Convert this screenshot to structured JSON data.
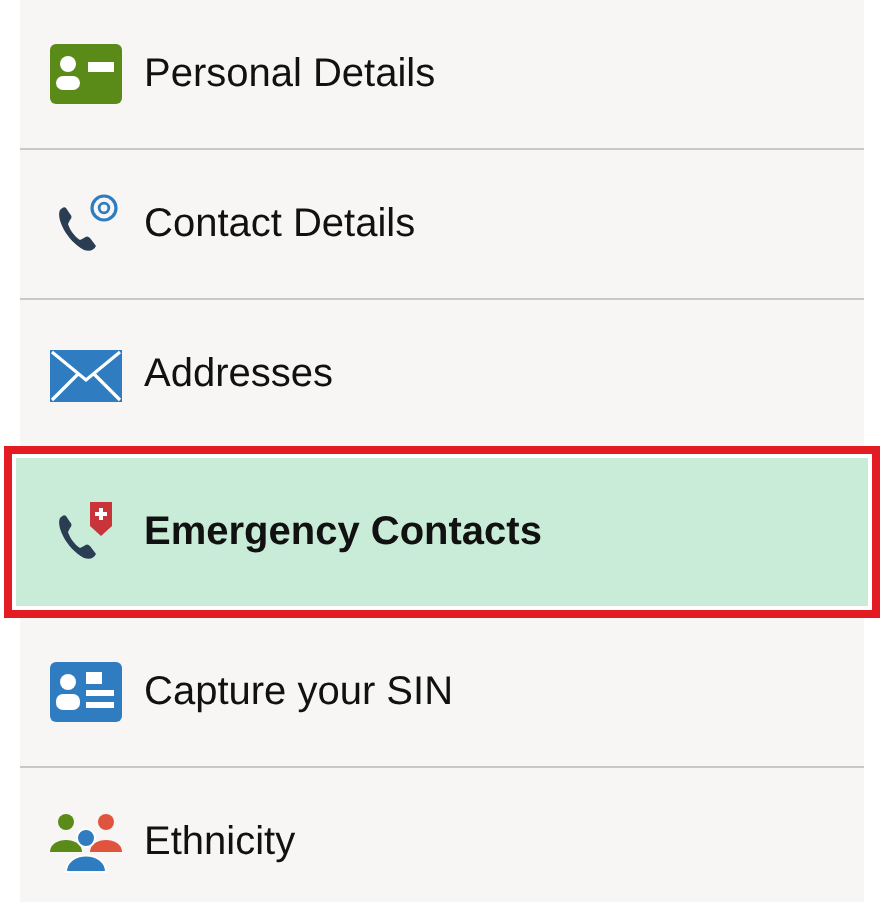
{
  "menu": [
    {
      "label": "Personal Details",
      "selected": false
    },
    {
      "label": "Contact Details",
      "selected": false
    },
    {
      "label": "Addresses",
      "selected": false
    },
    {
      "label": "Emergency Contacts",
      "selected": true
    },
    {
      "label": "Capture your SIN",
      "selected": false
    },
    {
      "label": "Ethnicity",
      "selected": false
    }
  ]
}
